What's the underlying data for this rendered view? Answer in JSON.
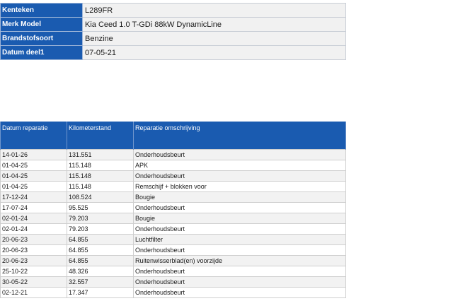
{
  "vehicle": {
    "rows": [
      {
        "label": "Kenteken",
        "value": "L289FR"
      },
      {
        "label": "Merk Model",
        "value": "Kia Ceed 1.0 T-GDi 88kW DynamicLine"
      },
      {
        "label": "Brandstofsoort",
        "value": "Benzine"
      },
      {
        "label": "Datum deel1",
        "value": "07-05-21"
      }
    ]
  },
  "repairs": {
    "headers": {
      "date": "Datum reparatie",
      "km": "Kilometerstand",
      "desc": "Reparatie omschrijving"
    },
    "rows": [
      {
        "date": "14-01-26",
        "km": "131.551",
        "desc": "Onderhoudsbeurt"
      },
      {
        "date": "01-04-25",
        "km": "115.148",
        "desc": "APK"
      },
      {
        "date": "01-04-25",
        "km": "115.148",
        "desc": "Onderhoudsbeurt"
      },
      {
        "date": "01-04-25",
        "km": "115.148",
        "desc": "Remschijf + blokken voor"
      },
      {
        "date": "17-12-24",
        "km": "108.524",
        "desc": "Bougie"
      },
      {
        "date": "17-07-24",
        "km": "95.525",
        "desc": "Onderhoudsbeurt"
      },
      {
        "date": "02-01-24",
        "km": "79.203",
        "desc": "Bougie"
      },
      {
        "date": "02-01-24",
        "km": "79.203",
        "desc": "Onderhoudsbeurt"
      },
      {
        "date": "20-06-23",
        "km": "64.855",
        "desc": "Luchtfilter"
      },
      {
        "date": "20-06-23",
        "km": "64.855",
        "desc": "Onderhoudsbeurt"
      },
      {
        "date": "20-06-23",
        "km": "64.855",
        "desc": "Ruitenwisserblad(en) voorzijde"
      },
      {
        "date": "25-10-22",
        "km": "48.326",
        "desc": "Onderhoudsbeurt"
      },
      {
        "date": "30-05-22",
        "km": "32.557",
        "desc": "Onderhoudsbeurt"
      },
      {
        "date": "02-12-21",
        "km": "17.347",
        "desc": "Onderhoudsbeurt"
      }
    ]
  },
  "colors": {
    "header_blue": "#1a5bb0",
    "row_grey": "#f2f2f2"
  }
}
